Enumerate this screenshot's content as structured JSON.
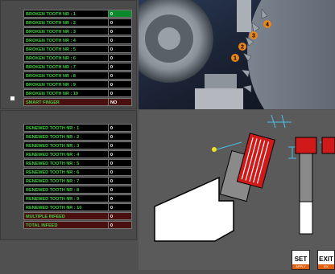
{
  "broken_table": {
    "rows": [
      {
        "label": "BROKEN TOOTH NR : 1",
        "value": "0"
      },
      {
        "label": "BROKEN TOOTH NR : 2",
        "value": "0"
      },
      {
        "label": "BROKEN TOOTH NR : 3",
        "value": "0"
      },
      {
        "label": "BROKEN TOOTH NR : 4",
        "value": "0"
      },
      {
        "label": "BROKEN TOOTH NR : 5",
        "value": "0"
      },
      {
        "label": "BROKEN TOOTH NR : 6",
        "value": "0"
      },
      {
        "label": "BROKEN TOOTH NR : 7",
        "value": "0"
      },
      {
        "label": "BROKEN TOOTH NR : 8",
        "value": "0"
      },
      {
        "label": "BROKEN TOOTH NR : 9",
        "value": "0"
      },
      {
        "label": "BROKEN TOOTH NR : 10",
        "value": "0"
      }
    ],
    "smart_finger": {
      "label": "SMART FINGER",
      "value": "NO"
    }
  },
  "renewed_table": {
    "rows": [
      {
        "label": "RENEWED TOOTH NR : 1",
        "value": "0"
      },
      {
        "label": "RENEWED TOOTH NR : 2",
        "value": "0"
      },
      {
        "label": "RENEWED TOOTH NR : 3",
        "value": "0"
      },
      {
        "label": "RENEWED TOOTH NR : 4",
        "value": "0"
      },
      {
        "label": "RENEWED TOOTH NR : 5",
        "value": "0"
      },
      {
        "label": "RENEWED TOOTH NR : 6",
        "value": "0"
      },
      {
        "label": "RENEWED TOOTH NR : 7",
        "value": "0"
      },
      {
        "label": "RENEWED TOOTH NR : 8",
        "value": "0"
      },
      {
        "label": "RENEWED TOOTH NR : 9",
        "value": "0"
      },
      {
        "label": "RENEWED TOOTH NR : 10",
        "value": "0"
      }
    ],
    "multiple_infeed": {
      "label": "MULTIPLE INFEED",
      "value": "0"
    },
    "total_infeed": {
      "label": "TOTAL INFEED",
      "value": "0"
    }
  },
  "photo_markers": [
    "1",
    "2",
    "3",
    "4"
  ],
  "buttons": {
    "set": {
      "label": "SET",
      "sub": "APPLY"
    },
    "exit": {
      "label": "EXIT",
      "sub": "EX"
    }
  },
  "colors": {
    "label_green": "#3fcf3f",
    "active_value": "#0a8a2a",
    "brown_row": "#4a0f0f",
    "marker_orange": "#e8851a",
    "tooth_red": "#d01a1a",
    "button_accent": "#e06010"
  }
}
